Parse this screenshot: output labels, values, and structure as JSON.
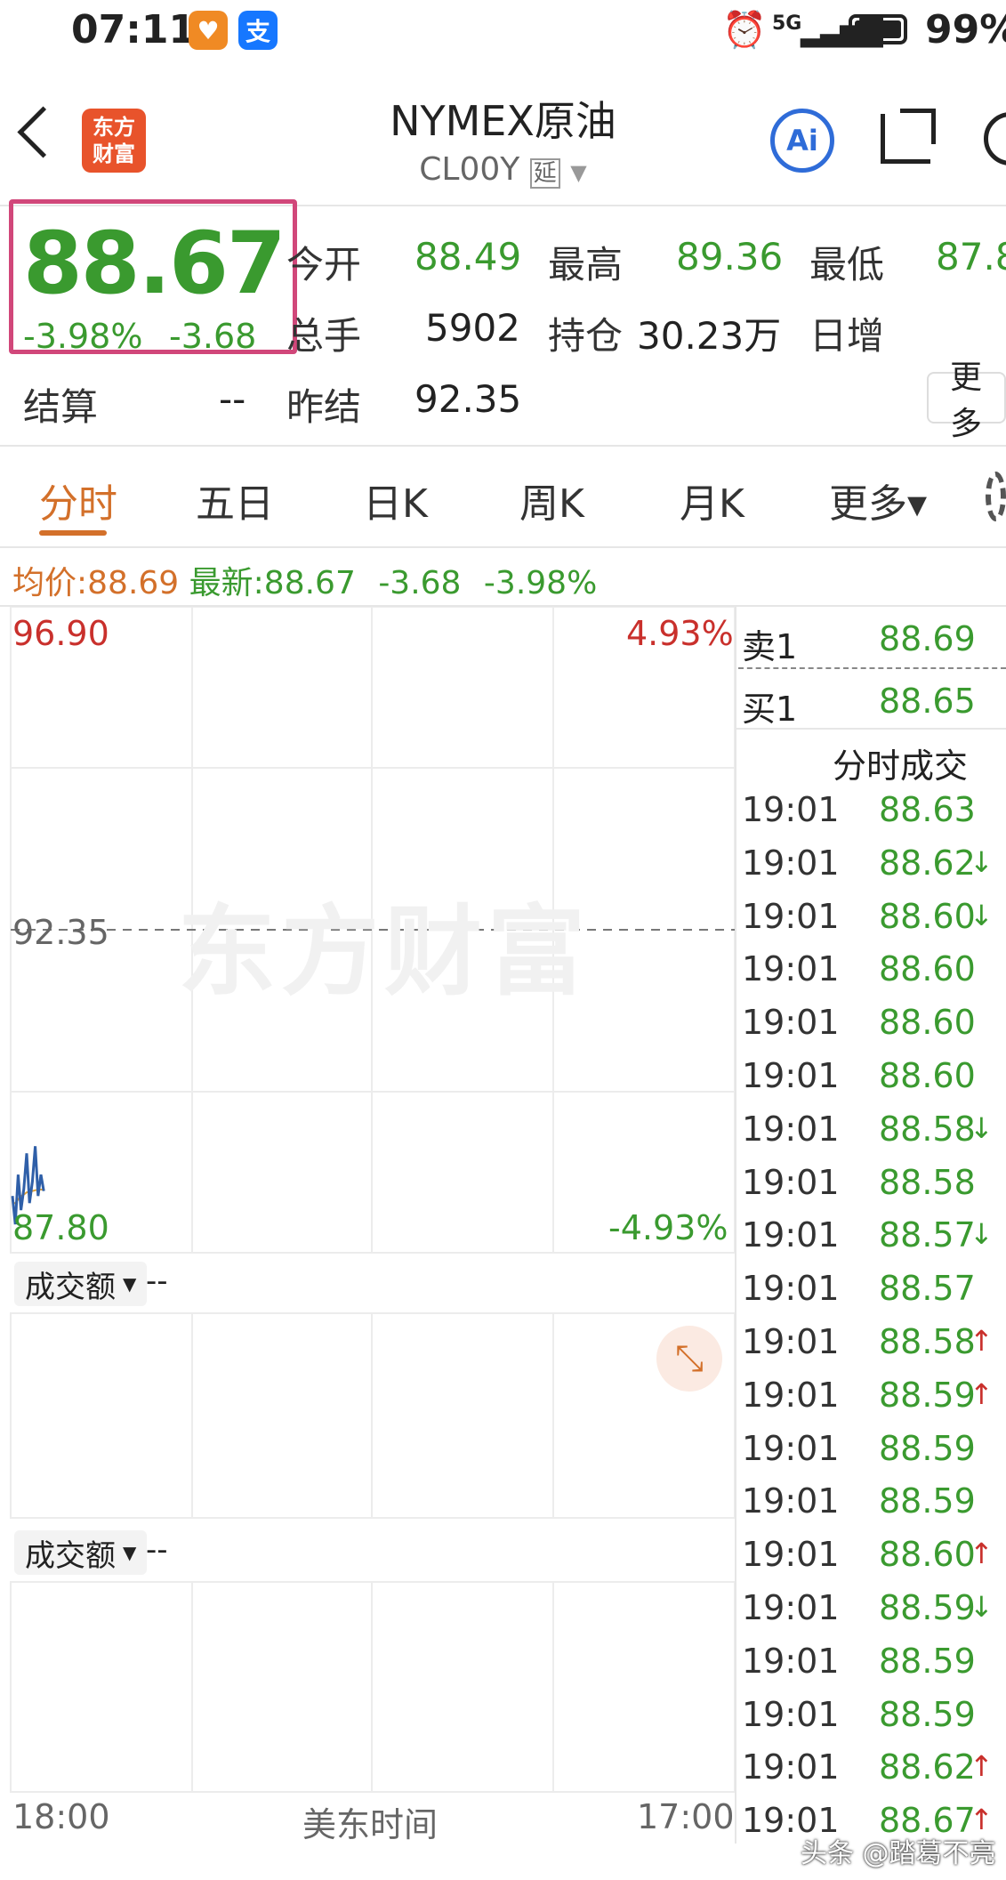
{
  "status_bar": {
    "time": "07:11",
    "network": "5G",
    "battery": "99%"
  },
  "header": {
    "logo_text": "东方财富",
    "title": "NYMEX原油",
    "code": "CL00Y",
    "delay_badge": "延",
    "ai_label": "Ai"
  },
  "quote": {
    "price": "88.67",
    "change_pct": "-3.98%",
    "change": "-3.68",
    "fields": [
      {
        "label": "今开",
        "value": "88.49"
      },
      {
        "label": "最高",
        "value": "89.36"
      },
      {
        "label": "最低",
        "value": "87.8"
      },
      {
        "label": "总手",
        "value": "5902"
      },
      {
        "label": "持仓",
        "value": "30.23万"
      },
      {
        "label": "日增",
        "value": ""
      },
      {
        "label": "结算",
        "value": "--"
      },
      {
        "label": "昨结",
        "value": "92.35"
      }
    ],
    "more_label": "更多"
  },
  "tabs": [
    {
      "label": "分时"
    },
    {
      "label": "五日"
    },
    {
      "label": "日K"
    },
    {
      "label": "周K"
    },
    {
      "label": "月K"
    },
    {
      "label": "更多▾"
    }
  ],
  "info_line": {
    "avg_label": "均价:",
    "avg_value": "88.69",
    "latest_label": "最新:",
    "latest_value": "88.67",
    "change": "-3.68",
    "change_pct": "-3.98%"
  },
  "chart_data": {
    "type": "line",
    "y_max": "96.90",
    "y_mid": "92.35",
    "y_min": "87.80",
    "pct_max": "4.93%",
    "pct_min": "-4.93%",
    "x_start": "18:00",
    "x_mid": "美东时间",
    "x_end": "17:00",
    "ylim": [
      87.8,
      96.9
    ],
    "series": [
      {
        "values": [
          88.6,
          88.2,
          88.9,
          88.4,
          88.7,
          89.2,
          88.5,
          88.8,
          89.3,
          88.6,
          88.9,
          88.67
        ]
      },
      {
        "values": [
          88.5,
          88.5,
          88.55,
          88.6,
          88.62,
          88.65,
          88.66,
          88.67,
          88.68,
          88.69,
          88.69,
          88.69
        ]
      }
    ]
  },
  "volume_panels": [
    {
      "label": "成交额",
      "value": "--"
    },
    {
      "label": "成交额",
      "value": "--"
    }
  ],
  "order_book": {
    "sell1_label": "卖1",
    "sell1_price": "88.69",
    "buy1_label": "买1",
    "buy1_price": "88.65",
    "trades_title": "分时成交"
  },
  "trades": [
    {
      "time": "19:01",
      "price": "88.63",
      "arrow": ""
    },
    {
      "time": "19:01",
      "price": "88.62",
      "arrow": "↓"
    },
    {
      "time": "19:01",
      "price": "88.60",
      "arrow": "↓"
    },
    {
      "time": "19:01",
      "price": "88.60",
      "arrow": ""
    },
    {
      "time": "19:01",
      "price": "88.60",
      "arrow": ""
    },
    {
      "time": "19:01",
      "price": "88.60",
      "arrow": ""
    },
    {
      "time": "19:01",
      "price": "88.58",
      "arrow": "↓"
    },
    {
      "time": "19:01",
      "price": "88.58",
      "arrow": ""
    },
    {
      "time": "19:01",
      "price": "88.57",
      "arrow": "↓"
    },
    {
      "time": "19:01",
      "price": "88.57",
      "arrow": ""
    },
    {
      "time": "19:01",
      "price": "88.58",
      "arrow": "↑"
    },
    {
      "time": "19:01",
      "price": "88.59",
      "arrow": "↑"
    },
    {
      "time": "19:01",
      "price": "88.59",
      "arrow": ""
    },
    {
      "time": "19:01",
      "price": "88.59",
      "arrow": ""
    },
    {
      "time": "19:01",
      "price": "88.60",
      "arrow": "↑"
    },
    {
      "time": "19:01",
      "price": "88.59",
      "arrow": "↓"
    },
    {
      "time": "19:01",
      "price": "88.59",
      "arrow": ""
    },
    {
      "time": "19:01",
      "price": "88.59",
      "arrow": ""
    },
    {
      "time": "19:01",
      "price": "88.62",
      "arrow": "↑"
    },
    {
      "time": "19:01",
      "price": "88.67",
      "arrow": "↑"
    }
  ],
  "watermark": "东方财富",
  "credit": "头条 @踏葛不亮",
  "colors": {
    "up": "#c9302c",
    "down": "#3a9a2f",
    "accent": "#d3702a",
    "highlight_box": "#d1477a",
    "price_line": "#2f5fa8",
    "avg_line": "#e0a23a"
  }
}
